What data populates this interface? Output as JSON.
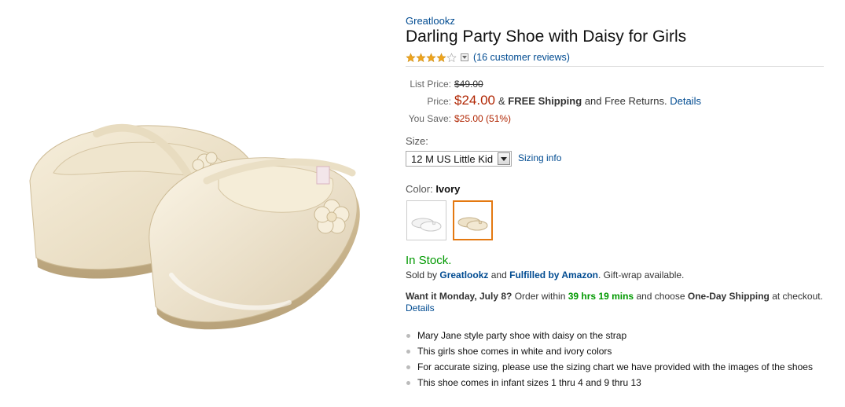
{
  "product": {
    "brand": "Greatlookz",
    "title": "Darling Party Shoe with Daisy for Girls",
    "rating_stars": 4,
    "reviews_link": "(16 customer reviews)"
  },
  "pricing": {
    "list_label": "List Price:",
    "list_value": "$49.00",
    "price_label": "Price:",
    "price_value": "$24.00",
    "shipping_amp": "&",
    "shipping_free": "FREE Shipping",
    "shipping_tail": "and Free Returns.",
    "details_link": "Details",
    "save_label": "You Save:",
    "save_value": "$25.00 (51%)"
  },
  "size": {
    "label": "Size:",
    "selected": "12 M US Little Kid",
    "sizing_info": "Sizing info"
  },
  "color": {
    "label": "Color:",
    "selected": "Ivory"
  },
  "availability": {
    "stock": "In Stock.",
    "sold_prefix": "Sold by",
    "seller": "Greatlookz",
    "and": "and",
    "fulfilled": "Fulfilled by Amazon",
    "gift": ". Gift-wrap available.",
    "want_it": "Want it Monday, July 8?",
    "order_within": "Order within",
    "countdown": "39 hrs 19 mins",
    "choose": "and choose",
    "one_day": "One-Day Shipping",
    "at_checkout": "at checkout.",
    "details_link": "Details"
  },
  "bullets": [
    "Mary Jane style party shoe with daisy on the strap",
    "This girls shoe comes in white and ivory colors",
    "For accurate sizing, please use the sizing chart we have provided with the images of the shoes",
    "This shoe comes in infant sizes 1 thru 4 and 9 thru 13"
  ],
  "colors": {
    "link": "#004B91",
    "price": "#B12704",
    "in_stock": "#009900",
    "selected_swatch_border": "#E47911",
    "star": "#F0A41C"
  }
}
